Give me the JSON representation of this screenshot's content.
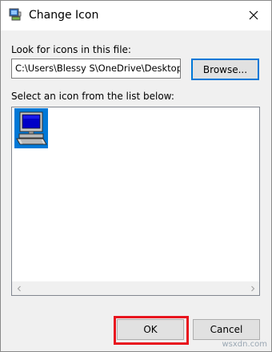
{
  "window": {
    "title": "Change Icon",
    "app_icon": "monitor-icon",
    "close_icon": "close-icon"
  },
  "file_section": {
    "label": "Look for icons in this file:",
    "path_value": "C:\\Users\\Blessy S\\OneDrive\\Desktop",
    "browse_label": "Browse..."
  },
  "icon_section": {
    "label": "Select an icon from the list below:",
    "items": [
      {
        "icon": "computer-icon",
        "selected": true
      }
    ],
    "scroll_left_icon": "chevron-left-icon",
    "scroll_right_icon": "chevron-right-icon"
  },
  "footer": {
    "ok_label": "OK",
    "cancel_label": "Cancel"
  },
  "colors": {
    "accent": "#0078d7",
    "highlight": "#e8141e"
  },
  "watermark": "wsxdn.com"
}
